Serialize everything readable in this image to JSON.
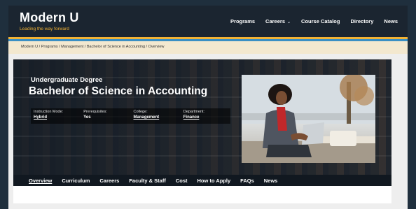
{
  "header": {
    "logo_title": "Modern U",
    "logo_tagline": "Leading the way forward",
    "nav": [
      "Programs",
      "Careers",
      "Course Catalog",
      "Directory",
      "News"
    ]
  },
  "breadcrumb": "Modern U / Programs / Management / Bachelor of Science in Accounting / Overview",
  "hero": {
    "subtitle": "Undergraduate Degree",
    "title": "Bachelor of Science in Accounting",
    "facts": [
      {
        "label": "Instruction Mode:",
        "value": "Hybrid"
      },
      {
        "label": "Prerequisites:",
        "value": "Yes"
      },
      {
        "label": "College:",
        "value": "Management"
      },
      {
        "label": "Department:",
        "value": "Finance"
      }
    ]
  },
  "subnav": [
    "Overview",
    "Curriculum",
    "Careers",
    "Faculty & Staff",
    "Cost",
    "How to Apply",
    "FAQs",
    "News"
  ],
  "colors": {
    "brand_dark": "#1b2530",
    "accent_gold": "#f2b233",
    "accent_blue": "#3a8fc4",
    "crumb_bg": "#f3e8cf"
  }
}
